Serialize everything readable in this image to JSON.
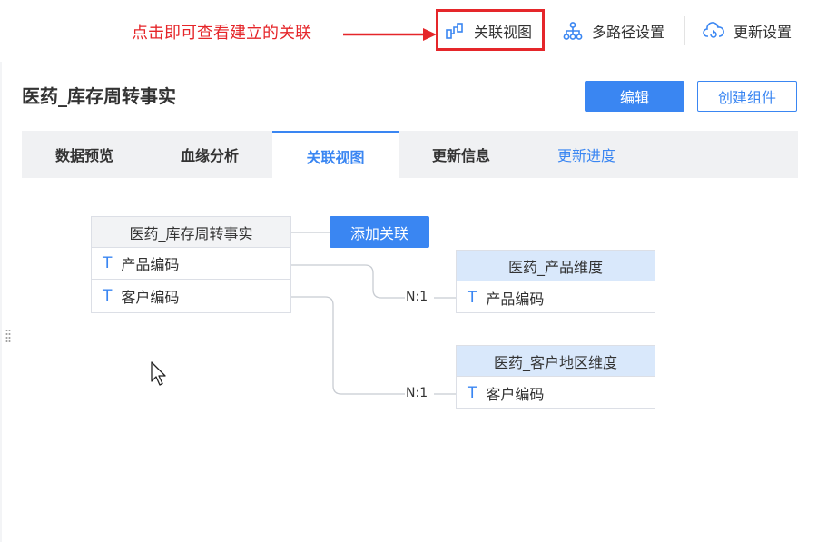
{
  "annotation": {
    "text": "点击即可查看建立的关联"
  },
  "toolbar": {
    "relation_view": {
      "label": "关联视图",
      "icon": "relation-view-icon"
    },
    "multipath": {
      "label": "多路径设置",
      "icon": "hierarchy-icon"
    },
    "update": {
      "label": "更新设置",
      "icon": "cloud-refresh-icon"
    }
  },
  "page": {
    "title": "医药_库存周转事实",
    "edit_label": "编辑",
    "create_label": "创建组件"
  },
  "tabs": [
    "数据预览",
    "血缘分析",
    "关联视图",
    "更新信息",
    "更新进度"
  ],
  "active_tab": "关联视图",
  "diagram": {
    "main_table": {
      "name": "医药_库存周转事实",
      "fields": [
        "产品编码",
        "客户编码"
      ]
    },
    "add_relation_label": "添加关联",
    "related_tables": [
      {
        "name": "医药_产品维度",
        "fields": [
          "产品编码"
        ],
        "relation": "N:1"
      },
      {
        "name": "医药_客户地区维度",
        "fields": [
          "客户编码"
        ],
        "relation": "N:1"
      }
    ]
  },
  "colors": {
    "accent": "#3a86f2",
    "annotation": "#e5262a",
    "related_header": "#d9e8fb"
  }
}
